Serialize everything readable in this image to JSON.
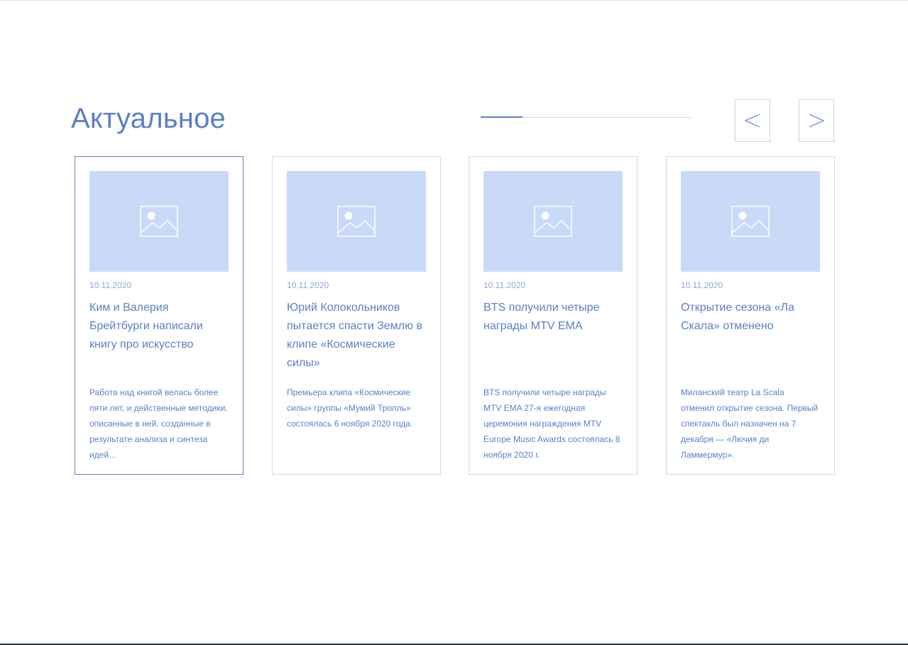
{
  "section": {
    "title": "Актуальное"
  },
  "slider": {
    "progress": 0.2
  },
  "navigation": {
    "prev_icon": "chevron-left-icon",
    "next_icon": "chevron-right-icon"
  },
  "colors": {
    "accent": "#5a7fc9",
    "image_placeholder": "#c9d9f8",
    "border": "#cfdbee"
  },
  "cards": [
    {
      "date": "10.11.2020",
      "title": "Ким и Валерия Брейтбурги написали книгу про искусство",
      "description": "Работа над книгой велась более пяти лет, и действенные методики, описанные в ней, созданные в результате анализа и синтеза идей…",
      "image_icon": "image-placeholder-icon"
    },
    {
      "date": "10.11.2020",
      "title": "Юрий Колокольников пытается спасти Землю в клипе «Космические силы»",
      "description": "Премьера клипа «Космические силы» группы «Мумий Тролль» состоялась 6 ноября 2020 года.",
      "image_icon": "image-placeholder-icon"
    },
    {
      "date": "10.11.2020",
      "title": "BTS получили четыре награды MTV EMA",
      "description": "BTS получили четыре награды MTV EMA 27-я ежегодная церемония награждения MTV Europe Music Awards состоялась 8 ноября 2020 г.",
      "image_icon": "image-placeholder-icon"
    },
    {
      "date": "10.11.2020",
      "title": "Открытие сезона «Ла Скала» отменено",
      "description": "Миланский театр La Scala отменил открытие сезона. Первый спектакль был назначен на 7 декабря — «Лючия ди Ламмермур».",
      "image_icon": "image-placeholder-icon"
    }
  ]
}
